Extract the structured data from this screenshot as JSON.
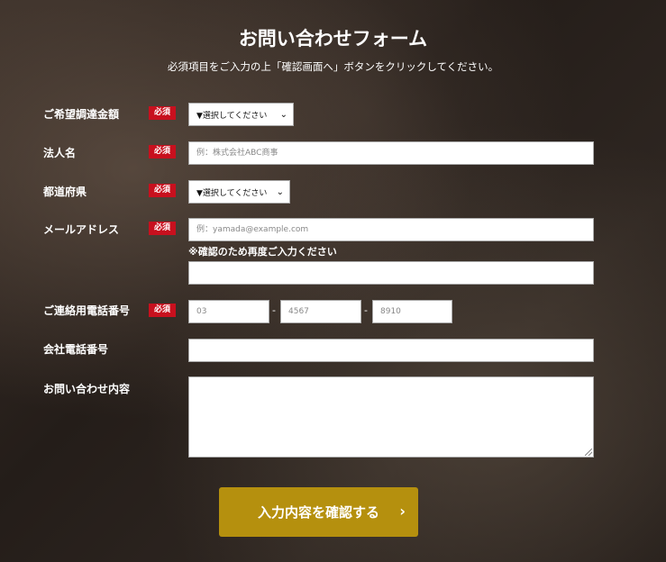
{
  "form": {
    "title": "お問い合わせフォーム",
    "subtitle": "必須項目をご入力の上「確認画面へ」ボタンをクリックしてください。",
    "required_badge": "必須",
    "fields": {
      "funding_amount": {
        "label": "ご希望調達金額",
        "selected": "▼選択してください"
      },
      "company_name": {
        "label": "法人名",
        "placeholder": "例：株式会社ABC商事"
      },
      "prefecture": {
        "label": "都道府県",
        "selected": "▼選択してください"
      },
      "email": {
        "label": "メールアドレス",
        "placeholder": "例：yamada@example.com",
        "confirm_note": "※確認のため再度ご入力ください"
      },
      "contact_phone": {
        "label": "ご連絡用電話番号",
        "placeholder_1": "03",
        "placeholder_2": "4567",
        "placeholder_3": "8910",
        "separator": "-"
      },
      "company_phone": {
        "label": "会社電話番号"
      },
      "inquiry": {
        "label": "お問い合わせ内容"
      }
    },
    "submit_label": "入力内容を確認する",
    "submit_arrow": "›",
    "chevron": "⌄"
  }
}
